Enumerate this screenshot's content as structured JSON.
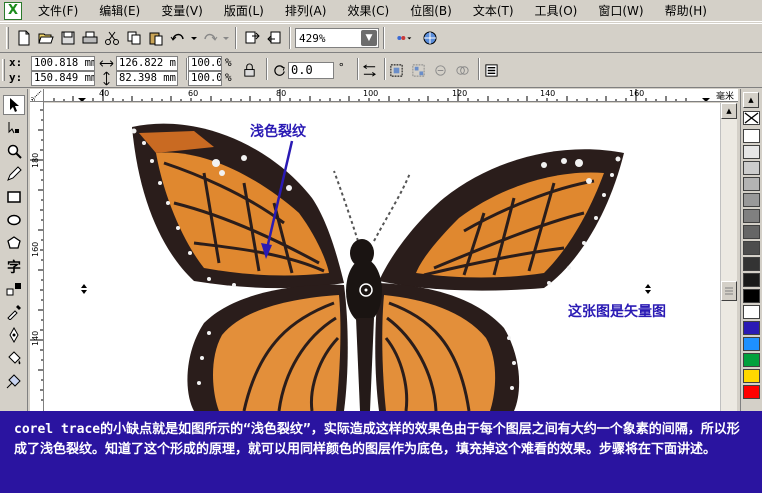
{
  "app": {
    "icon_letter": "X"
  },
  "menu": [
    "文件(F)",
    "编辑(E)",
    "变量(V)",
    "版面(L)",
    "排列(A)",
    "效果(C)",
    "位图(B)",
    "文本(T)",
    "工具(O)",
    "窗口(W)",
    "帮助(H)"
  ],
  "toolbar": {
    "zoom_value": "429%"
  },
  "propbar": {
    "x_label": "x:",
    "y_label": "y:",
    "x_value": "100.818 mm",
    "y_value": "150.849 mm",
    "width_value": "126.822 m",
    "height_value": "82.398 mm",
    "scale_x": "100.0",
    "scale_y": "100.0",
    "percent_symbol": "%",
    "rotation_value": "0.0",
    "degree_symbol": "°"
  },
  "ruler": {
    "unit": "毫米",
    "top_ticks": [
      "40",
      "60",
      "80",
      "100",
      "120",
      "140",
      "160"
    ],
    "left_ticks": [
      "180",
      "160",
      "140"
    ]
  },
  "annotations": {
    "light_crack": "浅色裂纹",
    "vector_note": "这张图是矢量图"
  },
  "caption": {
    "text": "corel trace的小缺点就是如图所示的“浅色裂纹”，实际造成这样的效果色由于每个图层之间有大约一个象素的间隔，所以形成了浅色裂纹。知道了这个形成的原理，就可以用同样颜色的图层作为底色，填充掉这个难看的效果。步骤将在下面讲述。"
  },
  "palette": [
    "#ffffff",
    "#e6e6e6",
    "#cccccc",
    "#b3b3b3",
    "#999999",
    "#808080",
    "#666666",
    "#4d4d4d",
    "#333333",
    "#1a1a1a",
    "#000000",
    "#ffffff",
    "#2a1ab4",
    "#1e90ff",
    "#00a03c",
    "#ffd800",
    "#ff0000"
  ],
  "colors": {
    "caption_bg": "#2a14a0",
    "annotation": "#2a1ab4",
    "chrome": "#d4d0c8"
  }
}
